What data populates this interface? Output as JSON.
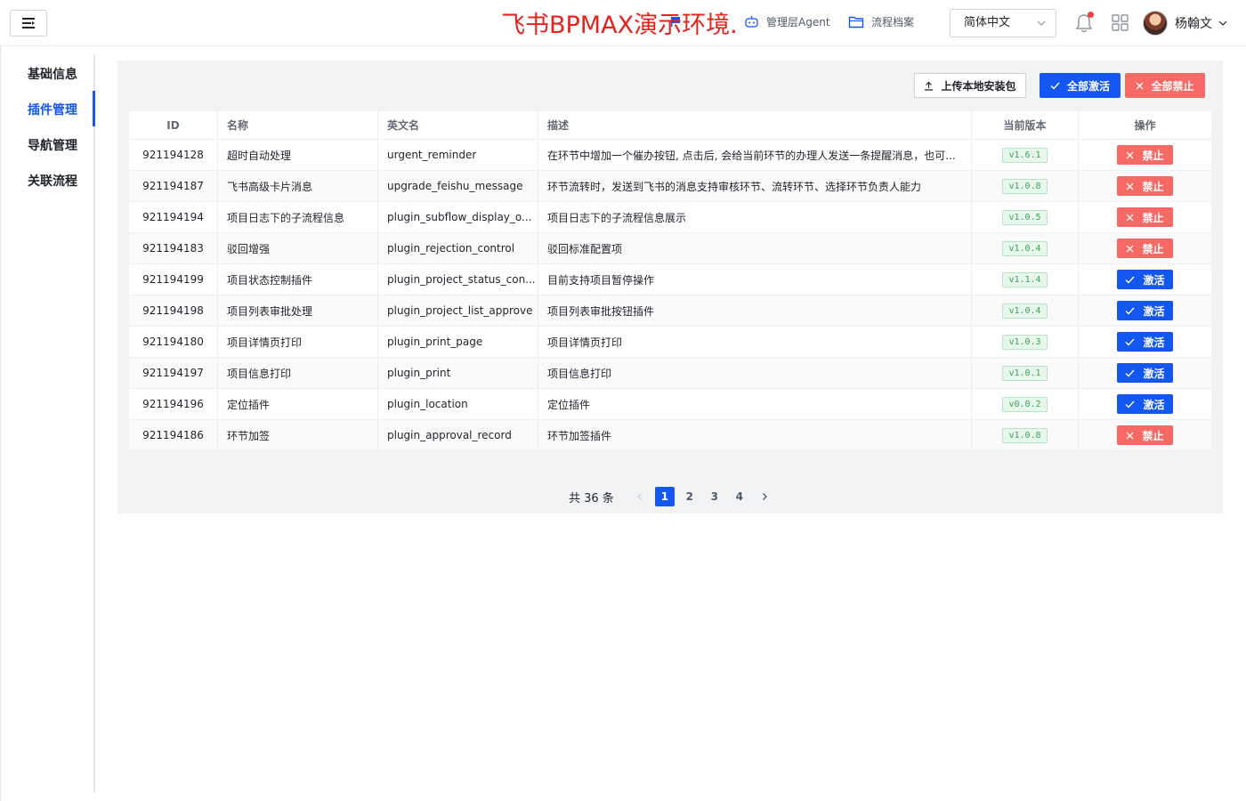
{
  "header": {
    "env_title": "飞书BPMAX演示环境.",
    "nav": [
      {
        "label": "管理层Agent",
        "icon": "bot-icon"
      },
      {
        "label": "流程档案",
        "icon": "folder-icon"
      }
    ],
    "language": "简体中文",
    "user_name": "杨翰文"
  },
  "sidebar": {
    "items": [
      {
        "label": "基础信息"
      },
      {
        "label": "插件管理"
      },
      {
        "label": "导航管理"
      },
      {
        "label": "关联流程"
      }
    ],
    "active_index": 1
  },
  "toolbar": {
    "upload_label": "上传本地安装包",
    "activate_all_label": "全部激活",
    "disable_all_label": "全部禁止"
  },
  "table": {
    "columns": [
      "ID",
      "名称",
      "英文名",
      "描述",
      "当前版本",
      "操作"
    ],
    "rows": [
      {
        "id": "921194128",
        "name": "超时自动处理",
        "en": "urgent_reminder",
        "desc": "在环节中增加一个催办按钮, 点击后, 会给当前环节的办理人发送一条提醒消息，也可...",
        "version": "v1.6.1",
        "action": "禁止"
      },
      {
        "id": "921194187",
        "name": "飞书高级卡片消息",
        "en": "upgrade_feishu_message",
        "desc": "环节流转时，发送到飞书的消息支持审核环节、流转环节、选择环节负责人能力",
        "version": "v1.0.8",
        "action": "禁止"
      },
      {
        "id": "921194194",
        "name": "项目日志下的子流程信息",
        "en": "plugin_subflow_display_o...",
        "desc": "项目日志下的子流程信息展示",
        "version": "v1.0.5",
        "action": "禁止"
      },
      {
        "id": "921194183",
        "name": "驳回增强",
        "en": "plugin_rejection_control",
        "desc": "驳回标准配置项",
        "version": "v1.0.4",
        "action": "禁止"
      },
      {
        "id": "921194199",
        "name": "项目状态控制插件",
        "en": "plugin_project_status_con...",
        "desc": "目前支持项目暂停操作",
        "version": "v1.1.4",
        "action": "激活"
      },
      {
        "id": "921194198",
        "name": "项目列表审批处理",
        "en": "plugin_project_list_approve",
        "desc": "项目列表审批按钮插件",
        "version": "v1.0.4",
        "action": "激活"
      },
      {
        "id": "921194180",
        "name": "项目详情页打印",
        "en": "plugin_print_page",
        "desc": "项目详情页打印",
        "version": "v1.0.3",
        "action": "激活"
      },
      {
        "id": "921194197",
        "name": "项目信息打印",
        "en": "plugin_print",
        "desc": "项目信息打印",
        "version": "v1.0.1",
        "action": "激活"
      },
      {
        "id": "921194196",
        "name": "定位插件",
        "en": "plugin_location",
        "desc": "定位插件",
        "version": "v0.0.2",
        "action": "激活"
      },
      {
        "id": "921194186",
        "name": "环节加签",
        "en": "plugin_approval_record",
        "desc": "环节加签插件",
        "version": "v1.0.8",
        "action": "禁止"
      }
    ]
  },
  "pagination": {
    "total_label": "共 36 条",
    "pages": [
      "1",
      "2",
      "3",
      "4"
    ],
    "current": "1"
  },
  "colors": {
    "primary": "#1456f0",
    "danger": "#f76965",
    "env_title": "#e5231b",
    "version_green": "#3fa05a"
  }
}
